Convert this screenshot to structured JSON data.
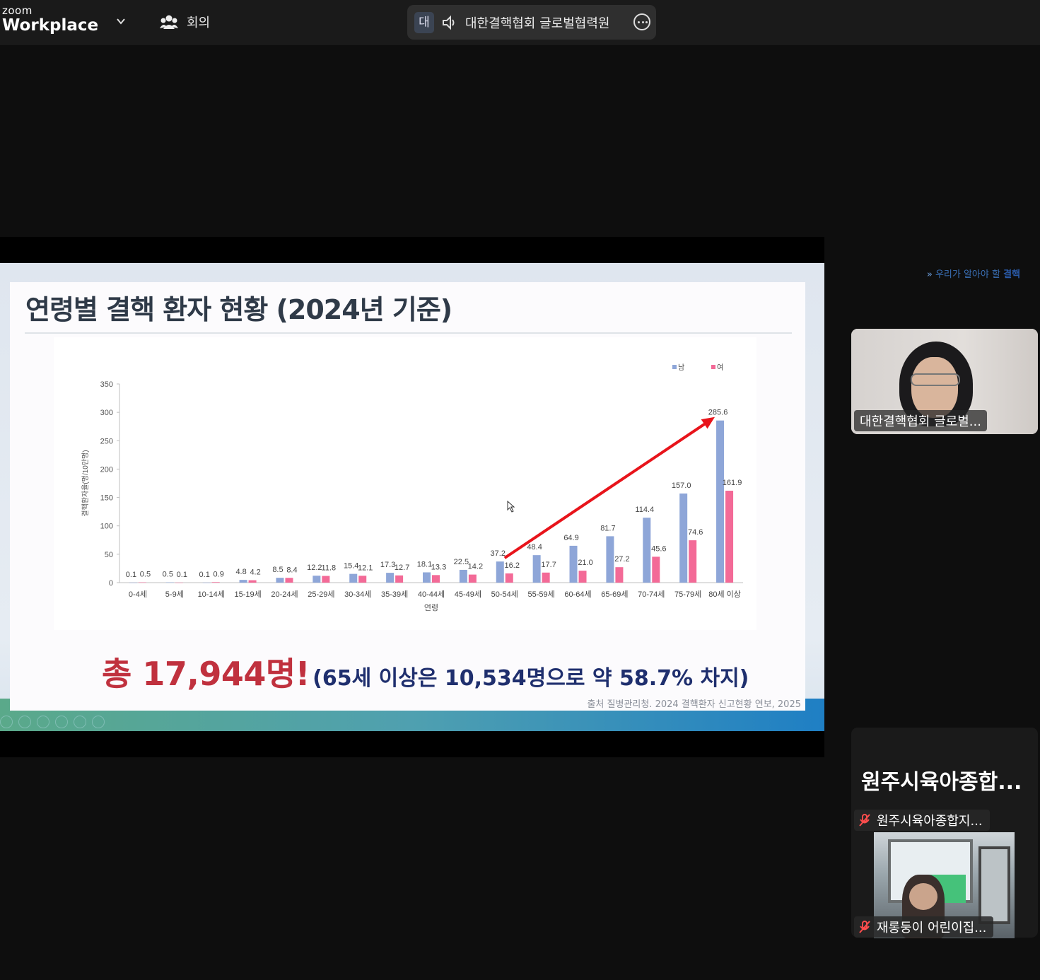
{
  "app": {
    "brand_small": "zoom",
    "brand_big": "Workplace",
    "meeting_label": "회의"
  },
  "speaker_pill": {
    "avatar_letter": "대",
    "speaker_name": "대한결핵협회 글로벌협력원"
  },
  "slide": {
    "breadcrumb_prefix": "우리가 알아야 할 ",
    "breadcrumb_bold": "결핵",
    "title": "연령별 결핵 환자 현황 (2024년 기준)",
    "summary_big": "총 17,944명!",
    "summary_sub": "(65세 이상은 10,534명으로 약 58.7% 차지)",
    "source": "출처 질병관리청. 2024 결핵환자 신고현황 연보, 2025"
  },
  "chart_data": {
    "type": "bar",
    "xlabel": "연령",
    "ylabel": "결핵환자율(명/10만명)",
    "ylim": [
      0,
      350
    ],
    "yticks": [
      0,
      50,
      100,
      150,
      200,
      250,
      300,
      350
    ],
    "categories": [
      "0-4세",
      "5-9세",
      "10-14세",
      "15-19세",
      "20-24세",
      "25-29세",
      "30-34세",
      "35-39세",
      "40-44세",
      "45-49세",
      "50-54세",
      "55-59세",
      "60-64세",
      "65-69세",
      "70-74세",
      "75-79세",
      "80세 이상"
    ],
    "series": [
      {
        "name": "남",
        "color": "#8ea6d8",
        "values": [
          0.1,
          0.5,
          0.1,
          4.8,
          8.5,
          12.2,
          15.4,
          17.3,
          18.1,
          22.5,
          37.2,
          48.4,
          64.9,
          81.7,
          114.4,
          157.0,
          285.6
        ]
      },
      {
        "name": "여",
        "color": "#f36a97",
        "values": [
          0.5,
          0.1,
          0.9,
          4.2,
          8.4,
          11.8,
          12.1,
          12.7,
          13.3,
          14.2,
          16.2,
          17.7,
          21.0,
          27.2,
          45.6,
          74.6,
          161.9
        ]
      }
    ],
    "legend_position": "top-right",
    "annotation": "red arrow trending upward from 50-54세 to 80세 이상"
  },
  "participants": [
    {
      "name": "대한결핵협회 글로벌...",
      "muted": false
    },
    {
      "name_large": "원주시육아종합...",
      "name": "원주시육아종합지...",
      "muted": true
    },
    {
      "name": "재롱둥이 어린이집...",
      "muted": true
    }
  ],
  "colors": {
    "title": "#2f3a48",
    "summary_red": "#c0313e",
    "summary_navy": "#1f2f6e",
    "arrow": "#e8141b"
  }
}
